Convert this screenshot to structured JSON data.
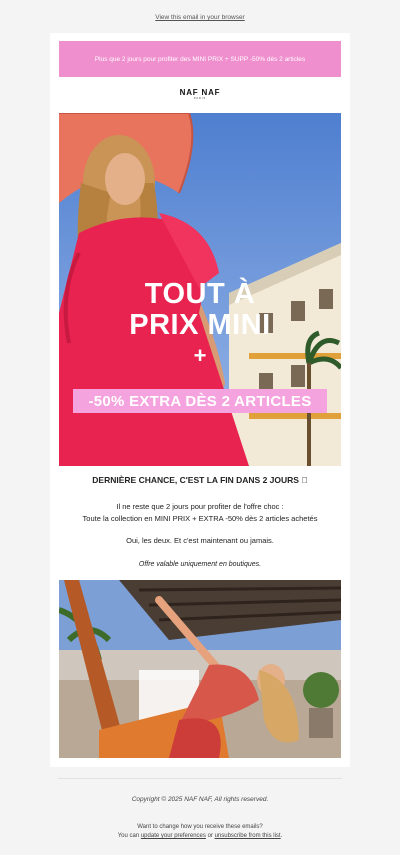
{
  "browser_link": "View this email in your browser",
  "promo_bar": "Plus que 2 jours pour profiter des MINI PRIX + SUPP -50% dès 2 articles",
  "logo": {
    "text": "NAF NAF",
    "sub": "PARIS"
  },
  "hero": {
    "line1": "TOUT À",
    "line2": "PRIX MINI",
    "plus": "+",
    "band": "-50% EXTRA DÈS 2 ARTICLES"
  },
  "headline": "DERNIÈRE CHANCE, C'EST LA FIN DANS 2 JOURS ⃞",
  "body": {
    "line1": "Il ne reste que 2 jours pour profiter de l'offre choc :",
    "line2": "Toute la collection en MINI PRIX + EXTRA -50% dès 2 articles achetés",
    "line3": "Oui, les deux. Et c'est maintenant ou jamais.",
    "note": "Offre valable uniquement en boutiques."
  },
  "footer": {
    "copyright": "Copyright © 2025 NAF NAF, All rights reserved.",
    "prefs_question": "Want to change how you receive these emails?",
    "prefs_prefix": "You can",
    "update_link": "update your preferences",
    "prefs_or": "or",
    "unsubscribe_link": "unsubscribe from this list",
    "prefs_end": "."
  },
  "colors": {
    "promo": "#ef8fce",
    "band": "#f5a3de",
    "dress": "#e8234f"
  }
}
